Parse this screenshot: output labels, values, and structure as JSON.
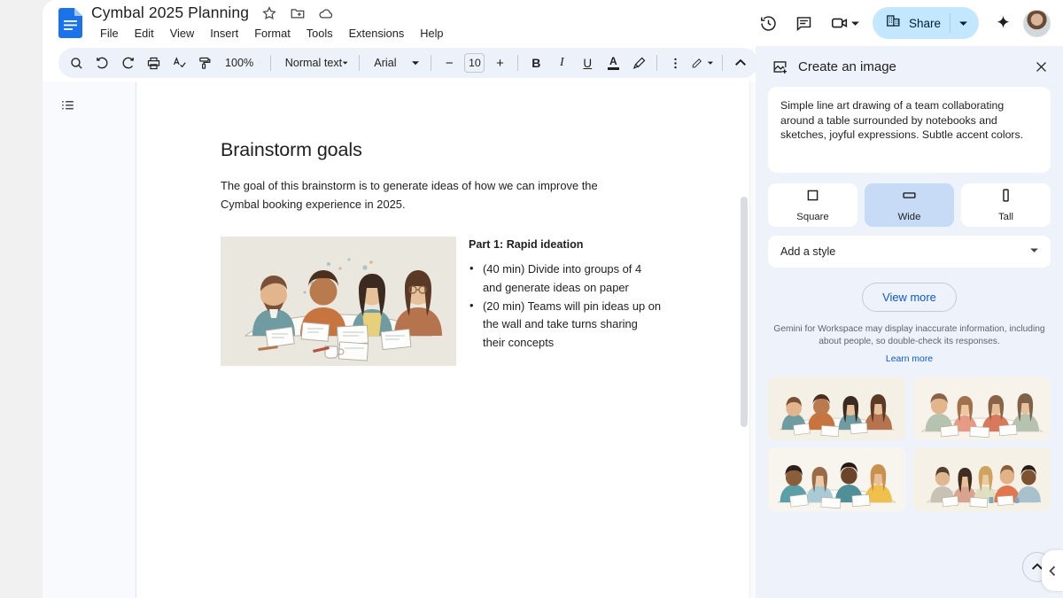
{
  "window": {
    "bg": "#f1f1f1"
  },
  "header": {
    "doc_icon": "google-docs-icon",
    "title": "Cymbal 2025 Planning",
    "star_icon": "star-icon",
    "move_icon": "move-to-folder-icon",
    "cloud_icon": "cloud-saved-icon",
    "menus": [
      "File",
      "Edit",
      "View",
      "Insert",
      "Format",
      "Tools",
      "Extensions",
      "Help"
    ],
    "history_icon": "version-history-icon",
    "comment_icon": "comment-icon",
    "meet_icon": "video-camera-icon",
    "share_label": "Share",
    "share_icon": "domain-share-icon",
    "gemini_icon": "gemini-spark-icon",
    "avatar": "user-avatar"
  },
  "toolbar": {
    "search": "search-icon",
    "undo": "undo-icon",
    "redo": "redo-icon",
    "print": "print-icon",
    "spellcheck": "spellcheck-icon",
    "paint_format": "paint-format-icon",
    "zoom_value": "100%",
    "style_value": "Normal text",
    "font_value": "Arial",
    "font_decrease": "−",
    "font_size": "10",
    "font_increase": "+",
    "bold": "B",
    "italic": "I",
    "underline": "U",
    "text_color": "A",
    "highlight": "highlight-pen-icon",
    "more": "more-options-icon",
    "edit_mode": "edit-mode-pen-icon",
    "collapse": "collapse-toolbar-icon"
  },
  "left_rail": {
    "outline_icon": "document-outline-icon"
  },
  "document": {
    "heading": "Brainstorm goals",
    "paragraph": "The goal of this brainstorm is to generate ideas of how we can improve the Cymbal booking experience in 2025.",
    "image_alt": "line-art illustration of four people collaborating around a table with notebooks and sketches",
    "section_title": "Part 1: Rapid ideation",
    "bullets": [
      "(40 min) Divide into groups of 4 and generate ideas on paper",
      "(20 min) Teams will pin ideas up on the wall and take turns sharing their concepts"
    ]
  },
  "side_panel": {
    "title": "Create an image",
    "title_icon": "add-image-icon",
    "close_icon": "close-icon",
    "prompt": "Simple line art drawing of a team collaborating around a table surrounded by notebooks and sketches, joyful expressions. Subtle accent colors.",
    "ratios": [
      {
        "label": "Square",
        "icon": "square-ratio-icon",
        "selected": false
      },
      {
        "label": "Wide",
        "icon": "wide-ratio-icon",
        "selected": true
      },
      {
        "label": "Tall",
        "icon": "tall-ratio-icon",
        "selected": false
      }
    ],
    "style_placeholder": "Add a style",
    "style_caret": "chevron-down-icon",
    "view_more": "View more",
    "disclaimer": "Gemini for Workspace may display inaccurate information, including about people, so double-check its responses.",
    "learn_more": "Learn more",
    "results": [
      {
        "alt": "four people around table, teal and orange tones"
      },
      {
        "alt": "four people around table, sage green and coral tones"
      },
      {
        "alt": "four people around table, yellow and blue tones"
      },
      {
        "alt": "five people around table, warm neutral tones"
      }
    ],
    "scroll_top_icon": "chevron-up-icon",
    "collapse_icon": "chevron-left-icon",
    "accent": "#0b57d0",
    "selected_bg": "#c7dbf7"
  }
}
